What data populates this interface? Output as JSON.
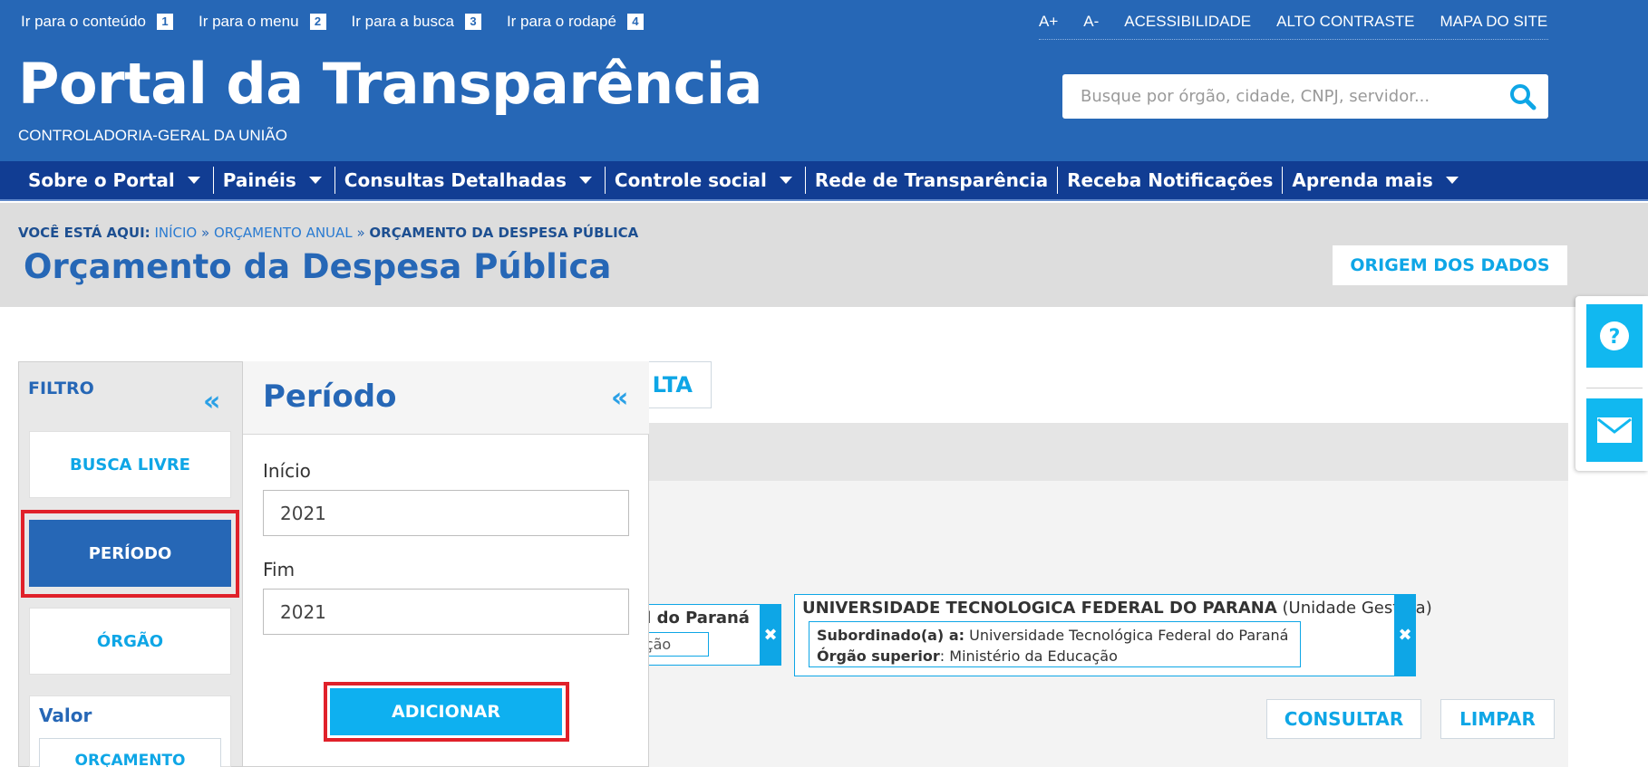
{
  "skip_links": [
    {
      "label": "Ir para o conteúdo",
      "key": "1"
    },
    {
      "label": "Ir para o menu",
      "key": "2"
    },
    {
      "label": "Ir para a busca",
      "key": "3"
    },
    {
      "label": "Ir para o rodapé",
      "key": "4"
    }
  ],
  "accessibility_links": [
    "A+",
    "A-",
    "ACESSIBILIDADE",
    "ALTO CONTRASTE",
    "MAPA DO SITE"
  ],
  "brand": {
    "title": "Portal da Transparência",
    "subtitle": "CONTROLADORIA-GERAL DA UNIÃO"
  },
  "search": {
    "placeholder": "Busque por órgão, cidade, CNPJ, servidor..."
  },
  "nav": [
    {
      "label": "Sobre o Portal",
      "dropdown": true
    },
    {
      "label": "Painéis",
      "dropdown": true
    },
    {
      "label": "Consultas Detalhadas",
      "dropdown": true
    },
    {
      "label": "Controle social",
      "dropdown": true
    },
    {
      "label": "Rede de Transparência",
      "dropdown": false
    },
    {
      "label": "Receba Notificações",
      "dropdown": false
    },
    {
      "label": "Aprenda mais",
      "dropdown": true
    }
  ],
  "breadcrumb": {
    "prefix": "VOCÊ ESTÁ AQUI:",
    "items": [
      "INÍCIO",
      "ORÇAMENTO ANUAL"
    ],
    "current": "ORÇAMENTO DA DESPESA PÚBLICA",
    "separator": "»"
  },
  "page": {
    "title": "Orçamento da Despesa Pública",
    "origin_button": "ORIGEM DOS DADOS"
  },
  "main": {
    "consulta_tab_visible": "LTA",
    "chip_left": {
      "title_visible": "al do Paraná",
      "sub_visible": "ação",
      "remove": "✖"
    },
    "chip_right": {
      "title": "UNIVERSIDADE TECNOLOGICA FEDERAL DO PARANA",
      "title_suffix": "(Unidade Gestora)",
      "subordinado_label": "Subordinado(a) a:",
      "subordinado_value": "Universidade Tecnológica Federal do Paraná",
      "orgao_label": "Órgão superior",
      "orgao_value": ": Ministério da Educação",
      "remove": "✖"
    },
    "consultar_button": "CONSULTAR",
    "limpar_button": "LIMPAR"
  },
  "filter": {
    "title": "FILTRO",
    "collapse": "«",
    "buttons": [
      "BUSCA LIVRE",
      "PERÍODO",
      "ÓRGÃO"
    ],
    "valor": {
      "title": "Valor",
      "button": "ORÇAMENTO"
    }
  },
  "periodo": {
    "title": "Período",
    "collapse": "«",
    "inicio_label": "Início",
    "inicio_value": "2021",
    "fim_label": "Fim",
    "fim_value": "2021",
    "add_button": "ADICIONAR"
  },
  "colors": {
    "header_blue": "#2667b6",
    "nav_blue": "#113d93",
    "accent_cyan": "#0ea6e6",
    "highlight_red": "#e0212a"
  }
}
